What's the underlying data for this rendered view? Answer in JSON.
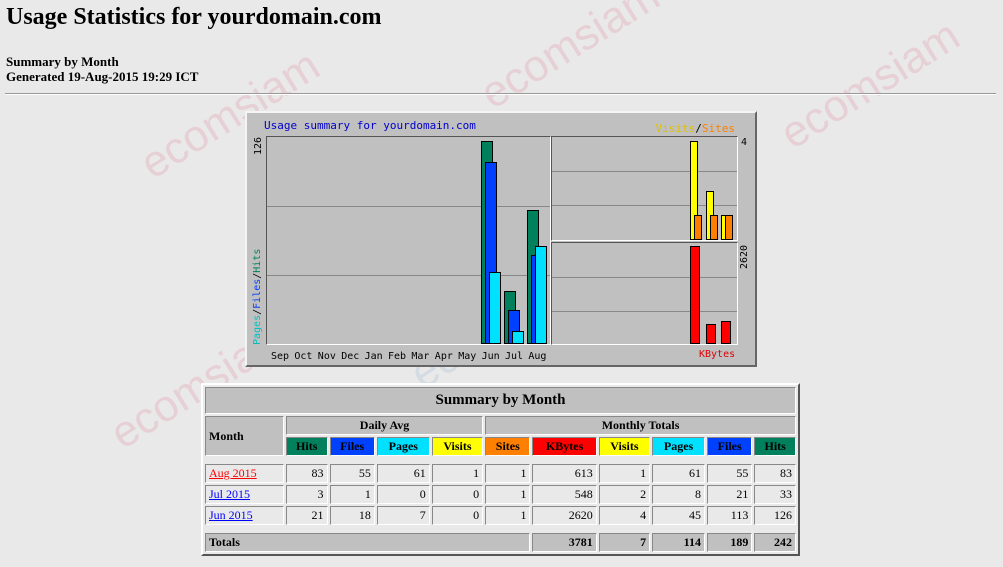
{
  "page": {
    "title": "Usage Statistics for yourdomain.com",
    "summary_heading": "Summary by Month",
    "generated": "Generated 19-Aug-2015 19:29 ICT",
    "watermark": "ecomsiam"
  },
  "chart": {
    "title": "Usage summary for yourdomain.com",
    "legend_visits": "Visits",
    "legend_sep": "/",
    "legend_sites": "Sites",
    "left_axis": {
      "pages": "Pages",
      "files": "Files",
      "hits": "Hits",
      "sep": "/"
    },
    "left_max_label": "126",
    "right_top_max_label": "4",
    "right_bottom_max_label": "2620",
    "kbytes_label": "KBytes",
    "colors": {
      "hits": "#00805c",
      "files": "#0040ff",
      "pages": "#00e0ff",
      "visits": "#ffff00",
      "sites": "#ff8000",
      "kbytes": "#ff0000"
    }
  },
  "chart_data": {
    "type": "bar",
    "categories": [
      "Sep",
      "Oct",
      "Nov",
      "Dec",
      "Jan",
      "Feb",
      "Mar",
      "Apr",
      "May",
      "Jun",
      "Jul",
      "Aug"
    ],
    "series": [
      {
        "name": "Hits",
        "values": [
          0,
          0,
          0,
          0,
          0,
          0,
          0,
          0,
          0,
          126,
          33,
          83
        ]
      },
      {
        "name": "Files",
        "values": [
          0,
          0,
          0,
          0,
          0,
          0,
          0,
          0,
          0,
          113,
          21,
          55
        ]
      },
      {
        "name": "Pages",
        "values": [
          0,
          0,
          0,
          0,
          0,
          0,
          0,
          0,
          0,
          45,
          8,
          61
        ]
      },
      {
        "name": "Visits",
        "values": [
          0,
          0,
          0,
          0,
          0,
          0,
          0,
          0,
          0,
          4,
          2,
          1
        ]
      },
      {
        "name": "Sites",
        "values": [
          0,
          0,
          0,
          0,
          0,
          0,
          0,
          0,
          0,
          1,
          1,
          1
        ]
      },
      {
        "name": "KBytes",
        "values": [
          0,
          0,
          0,
          0,
          0,
          0,
          0,
          0,
          0,
          2620,
          548,
          613
        ]
      }
    ]
  },
  "table": {
    "title": "Summary by Month",
    "month_header": "Month",
    "daily_avg": "Daily Avg",
    "monthly_totals": "Monthly Totals",
    "daily_cols": [
      "Hits",
      "Files",
      "Pages",
      "Visits"
    ],
    "monthly_cols": [
      "Sites",
      "KBytes",
      "Visits",
      "Pages",
      "Files",
      "Hits"
    ],
    "rows": [
      {
        "month": "Aug 2015",
        "cells": [
          "83",
          "55",
          "61",
          "1",
          "1",
          "613",
          "1",
          "61",
          "55",
          "83"
        ]
      },
      {
        "month": "Jul 2015",
        "cells": [
          "3",
          "1",
          "0",
          "0",
          "1",
          "548",
          "2",
          "8",
          "21",
          "33"
        ]
      },
      {
        "month": "Jun 2015",
        "cells": [
          "21",
          "18",
          "7",
          "0",
          "1",
          "2620",
          "4",
          "45",
          "113",
          "126"
        ]
      }
    ],
    "totals_label": "Totals",
    "totals": [
      "3781",
      "7",
      "114",
      "189",
      "242"
    ]
  }
}
